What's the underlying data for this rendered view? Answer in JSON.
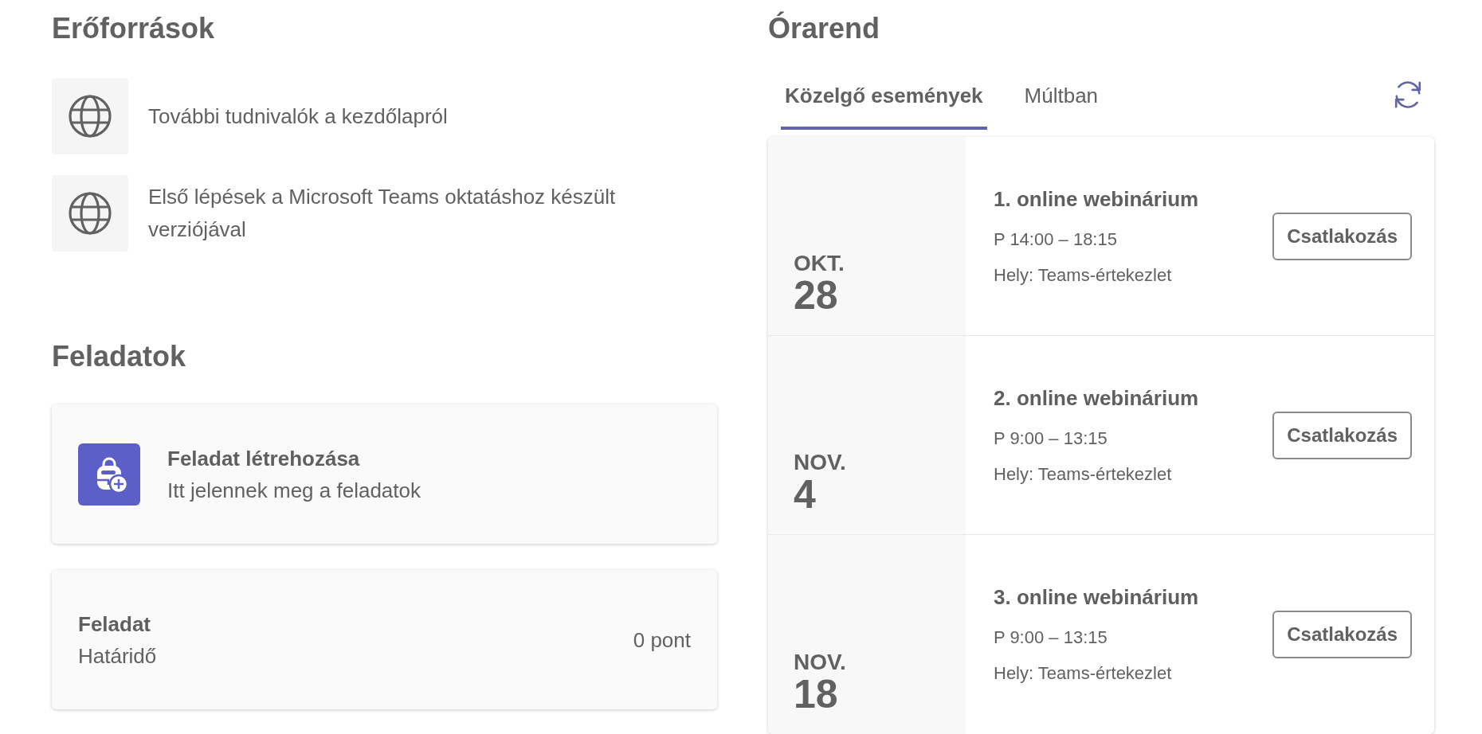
{
  "resources": {
    "title": "Erőforrások",
    "items": [
      {
        "label": "További tudnivalók a kezdőlapról"
      },
      {
        "label": "Első lépések a Microsoft Teams oktatáshoz készült verziójával"
      }
    ]
  },
  "assignments": {
    "title": "Feladatok",
    "cards": [
      {
        "kind": "create",
        "title": "Feladat létrehozása",
        "subtitle": "Itt jelennek meg a feladatok"
      },
      {
        "kind": "assignment",
        "title": "Feladat",
        "subtitle": "Határidő",
        "points": "0 pont"
      }
    ]
  },
  "schedule": {
    "title": "Órarend",
    "tabs": [
      {
        "label": "Közelgő események",
        "selected": true
      },
      {
        "label": "Múltban",
        "selected": false
      }
    ],
    "events": [
      {
        "month": "OKT.",
        "day": "28",
        "title": "1. online webinárium",
        "time": "P 14:00 – 18:15",
        "location": "Hely: Teams-értekezlet",
        "button": "Csatlakozás"
      },
      {
        "month": "NOV.",
        "day": "4",
        "title": "2. online webinárium",
        "time": "P 9:00 – 13:15",
        "location": "Hely: Teams-értekezlet",
        "button": "Csatlakozás"
      },
      {
        "month": "NOV.",
        "day": "18",
        "title": "3. online webinárium",
        "time": "P 9:00 – 13:15",
        "location": "Hely: Teams-értekezlet",
        "button": "Csatlakozás"
      }
    ]
  }
}
